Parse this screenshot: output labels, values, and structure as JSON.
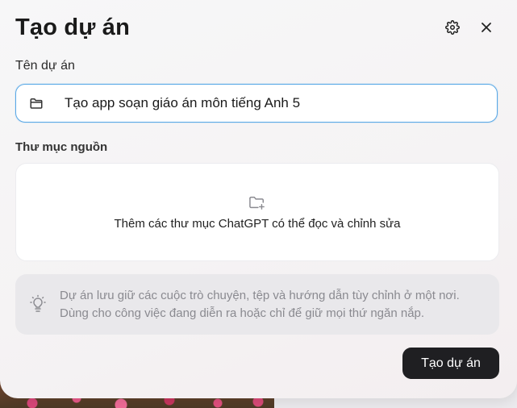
{
  "dialog": {
    "title": "Tạo dự án",
    "settings_icon": "gear-icon",
    "close_icon": "close-icon"
  },
  "project_name": {
    "label": "Tên dự án",
    "icon": "folder-icon",
    "value": "Tạo app soạn giáo án môn tiếng Anh 5"
  },
  "source_folders": {
    "label": "Thư mục nguồn",
    "icon": "folder-plus-icon",
    "prompt": "Thêm các thư mục ChatGPT có thể đọc và chỉnh sửa"
  },
  "info": {
    "icon": "lightbulb-icon",
    "text_line1": "Dự án lưu giữ các cuộc trò chuyện, tệp và hướng dẫn tùy chỉnh ở một nơi.",
    "text_line2": "Dùng cho công việc đang diễn ra hoặc chỉ để giữ mọi thứ ngăn nắp."
  },
  "actions": {
    "create_label": "Tạo dự án"
  },
  "colors": {
    "focus_border": "#5aa9e6",
    "primary_button": "#1f1f22"
  }
}
